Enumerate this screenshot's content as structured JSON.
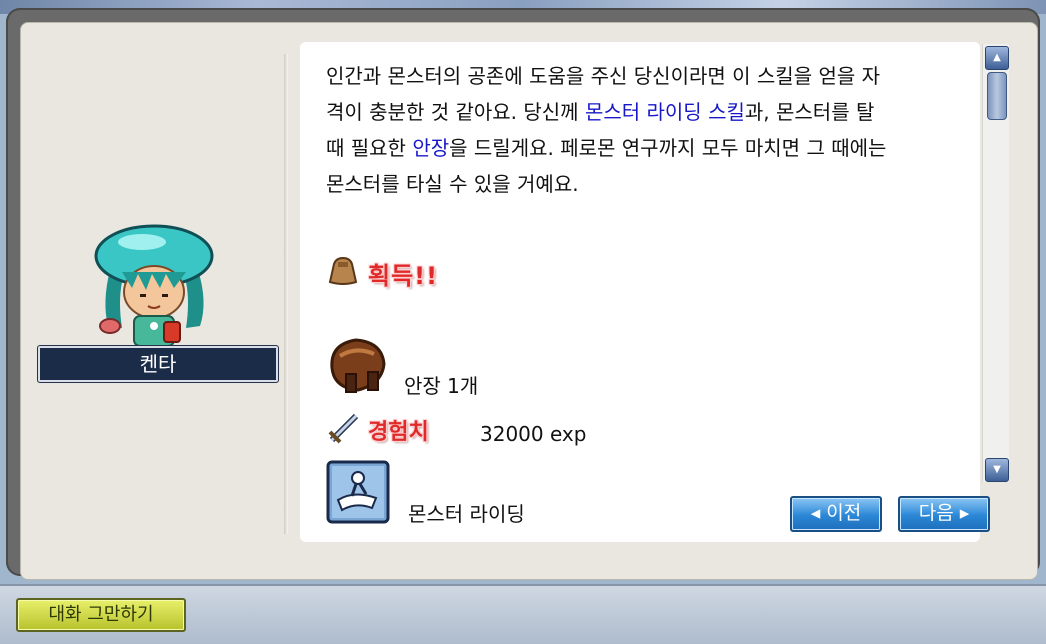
{
  "npc": {
    "name": "켄타"
  },
  "dialog": {
    "line1": "인간과 몬스터의 공존에 도움을 주신 당신이라면 이 스킬을 얻을 자",
    "line2a": "격이 충분한 것 같아요. 당신께 ",
    "line2_hl": "몬스터 라이딩 스킬",
    "line2b": "과, 몬스터를 탈",
    "line3a": "때 필요한 ",
    "line3_hl": "안장",
    "line3b": "을 드릴게요. 페로몬 연구까지 모두 마치면 그 때에는",
    "line4": "몬스터를 타실 수 있을 거예요."
  },
  "rewards": {
    "obtain_label": "획득!!",
    "item_label": "안장 1개",
    "exp_label": "경험치",
    "exp_value": "32000 exp",
    "skill_label": "몬스터 라이딩"
  },
  "buttons": {
    "prev": "◂ 이전",
    "next": "다음 ▸",
    "end_chat": "대화 그만하기"
  },
  "colors": {
    "highlight": "#1818c8",
    "reward_red": "#e02a2a"
  }
}
